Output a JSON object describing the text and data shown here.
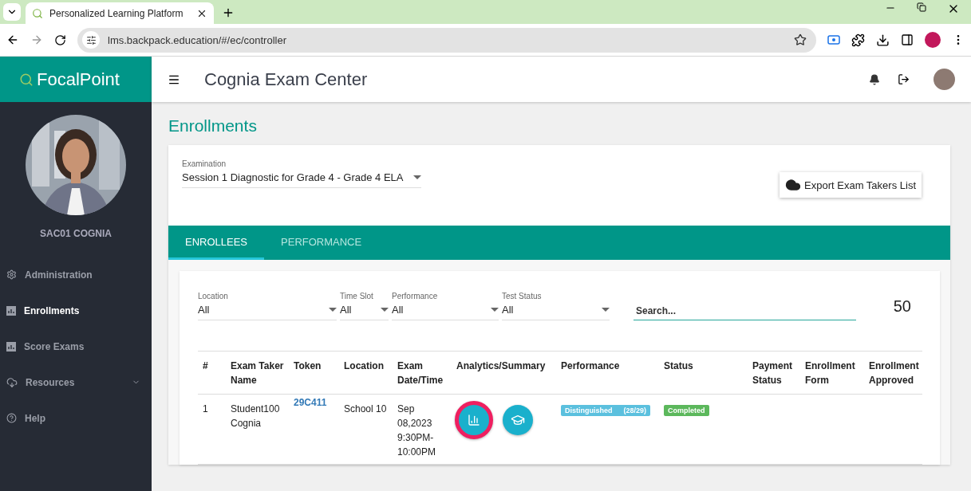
{
  "browser": {
    "tab_title": "Personalized Learning Platform",
    "url": "lms.backpack.education/#/ec/controller"
  },
  "app": {
    "brand": "FocalPoint",
    "header_title": "Cognia Exam Center"
  },
  "sidebar": {
    "user_name": "SAC01 COGNIA",
    "items": [
      {
        "label": "Administration",
        "kind": "gear",
        "selected": false
      },
      {
        "label": "Enrollments",
        "kind": "chart",
        "selected": true
      },
      {
        "label": "Score Exams",
        "kind": "chart",
        "selected": false
      },
      {
        "label": "Resources",
        "kind": "cloud",
        "selected": false,
        "expandable": true
      },
      {
        "label": "Help",
        "kind": "help",
        "selected": false
      }
    ]
  },
  "page_title": "Enrollments",
  "examination": {
    "label": "Examination",
    "value": "Session 1 Diagnostic for Grade 4 - Grade 4 ELA"
  },
  "export_button": "Export Exam Takers List",
  "tabs": [
    {
      "label": "ENROLLEES",
      "selected": true
    },
    {
      "label": "PERFORMANCE",
      "selected": false
    }
  ],
  "filters": [
    {
      "label": "Location",
      "value": "All"
    },
    {
      "label": "Time Slot",
      "value": "All"
    },
    {
      "label": "Performance",
      "value": "All"
    },
    {
      "label": "Test Status",
      "value": "All"
    }
  ],
  "search": {
    "placeholder": "Search..."
  },
  "count": "50",
  "table": {
    "columns": [
      "#",
      "Exam Taker Name",
      "Token",
      "Location",
      "Exam Date/Time",
      "Analytics/Summary",
      "Performance",
      "Status",
      "Payment Status",
      "Enrollment Form",
      "Enrollment Approved"
    ],
    "rows": [
      {
        "number": "1",
        "name": "Student100 Cognia",
        "token": "29C411",
        "location": "School 10",
        "date_time": "Sep 08,2023 9:30PM-10:00PM",
        "actions": [
          {
            "kind": "chart",
            "selected": true
          },
          {
            "kind": "cap",
            "selected": false
          }
        ],
        "performance": {
          "label": "Distinguished",
          "score": "(28/29)"
        },
        "status": "Completed"
      }
    ]
  }
}
